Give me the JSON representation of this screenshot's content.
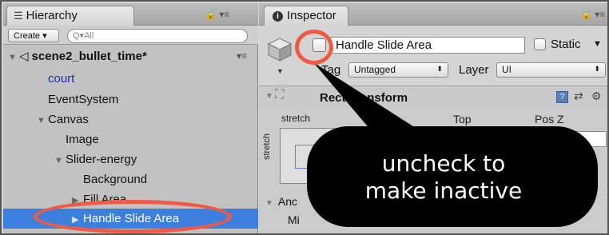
{
  "hierarchy": {
    "tab_title": "Hierarchy",
    "create_label": "Create ▾",
    "search_placeholder": "Q▾All",
    "scene_name": "scene2_bullet_time*",
    "items": [
      {
        "label": "court"
      },
      {
        "label": "EventSystem"
      },
      {
        "label": "Canvas"
      },
      {
        "label": "Image"
      },
      {
        "label": "Slider-energy"
      },
      {
        "label": "Background"
      },
      {
        "label": "Fill Area"
      },
      {
        "label": "Handle Slide Area"
      }
    ],
    "selected_item": "Handle Slide Area"
  },
  "inspector": {
    "tab_title": "Inspector",
    "object_name": "Handle Slide Area",
    "active_checked": false,
    "static_label": "Static",
    "static_checked": false,
    "tag_label": "Tag",
    "tag_value": "Untagged",
    "layer_label": "Layer",
    "layer_value": "UI",
    "component_title": "Rect Transform",
    "columns": {
      "stretch": "stretch",
      "top": "Top",
      "posz": "Pos Z"
    },
    "stretch_vertical": "stretch",
    "anchors_label": "Anc",
    "min_label": "Mi"
  },
  "annotation": {
    "callout_line1": "uncheck to",
    "callout_line2": "make inactive",
    "highlight_color": "#f05a45",
    "callout_color": "#000000"
  },
  "colors": {
    "selection": "#3d7fde",
    "court_text": "#1d2fb8"
  }
}
